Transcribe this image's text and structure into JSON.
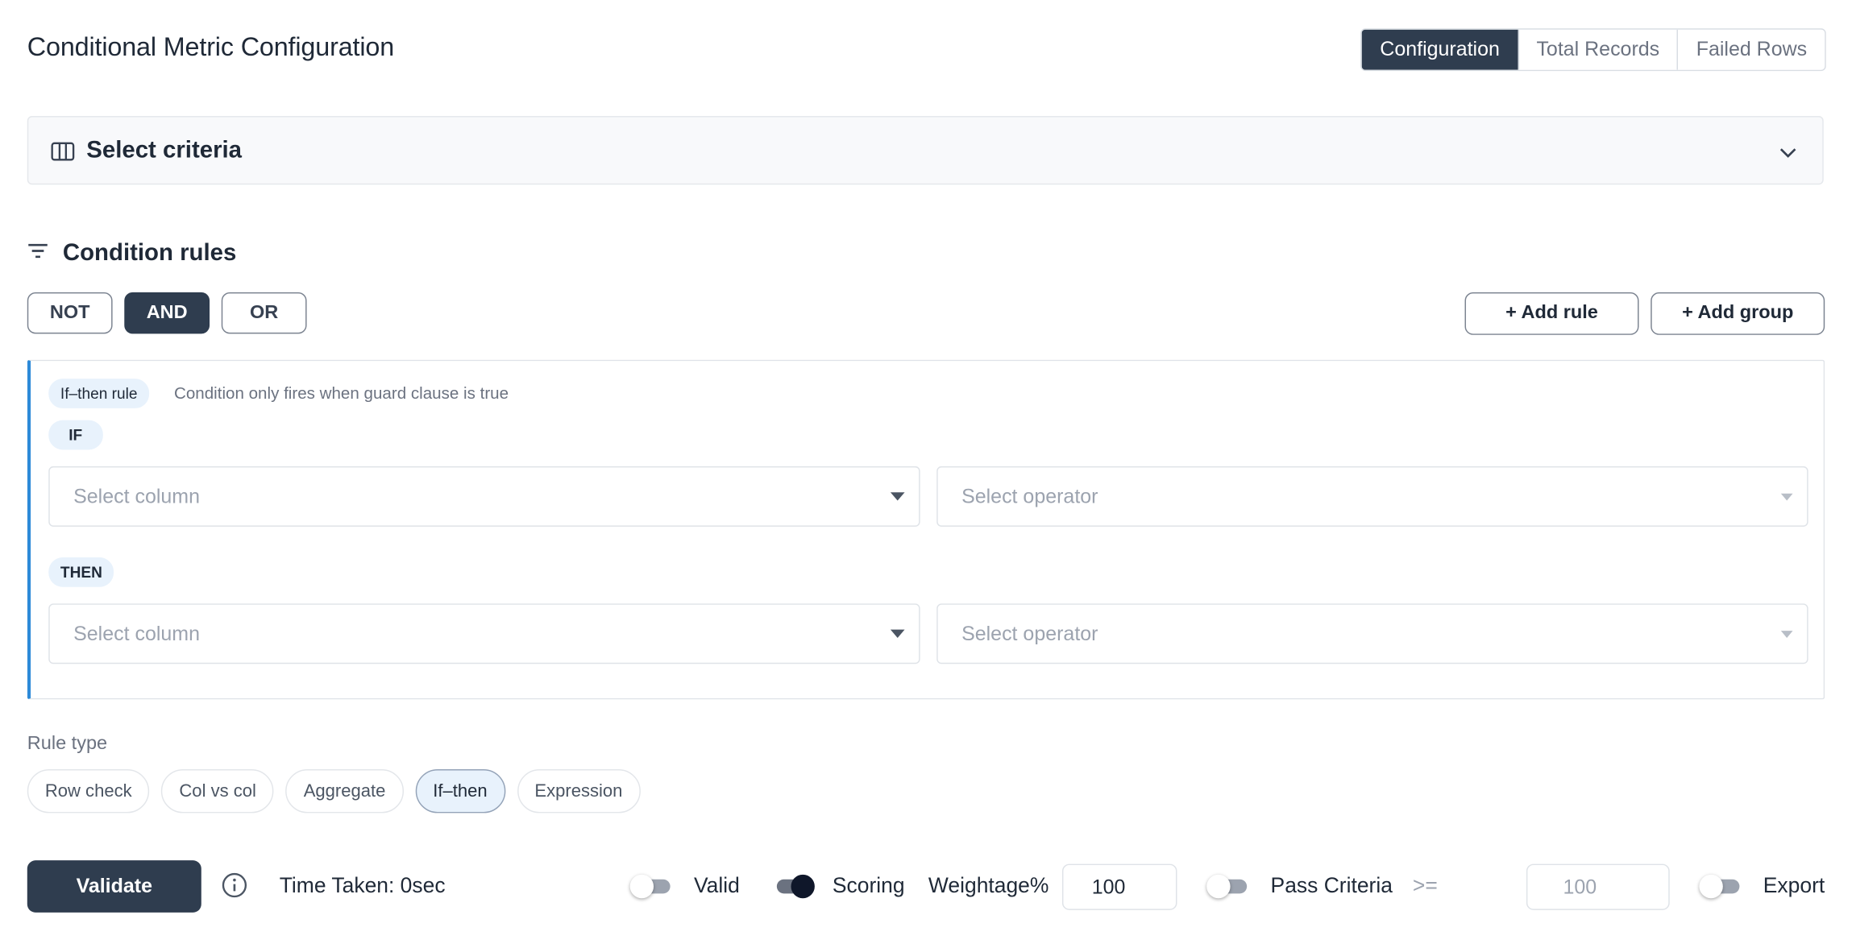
{
  "header": {
    "title": "Conditional Metric Configuration",
    "tabs": [
      {
        "label": "Configuration",
        "active": true
      },
      {
        "label": "Total Records",
        "active": false
      },
      {
        "label": "Failed Rows",
        "active": false
      }
    ]
  },
  "criteria": {
    "label": "Select criteria",
    "icon": "columns-icon",
    "expand_icon": "chevron-down-icon"
  },
  "condition_rules": {
    "title": "Condition rules",
    "icon": "filter-icon",
    "logic_buttons": [
      {
        "label": "NOT",
        "active": false
      },
      {
        "label": "AND",
        "active": true
      },
      {
        "label": "OR",
        "active": false
      }
    ],
    "add_rule_label": "+ Add rule",
    "add_group_label": "+ Add group"
  },
  "rule": {
    "type_badge": "If–then rule",
    "hint": "Condition only fires when guard clause is true",
    "if_label": "IF",
    "then_label": "THEN",
    "if_column_placeholder": "Select column",
    "if_operator_placeholder": "Select operator",
    "then_column_placeholder": "Select column",
    "then_operator_placeholder": "Select operator"
  },
  "rule_type": {
    "label": "Rule type",
    "options": [
      {
        "label": "Row check",
        "active": false
      },
      {
        "label": "Col vs col",
        "active": false
      },
      {
        "label": "Aggregate",
        "active": false
      },
      {
        "label": "If–then",
        "active": true
      },
      {
        "label": "Expression",
        "active": false
      }
    ]
  },
  "footer": {
    "validate_label": "Validate",
    "info_icon": "info-icon",
    "time_taken": "Time Taken: 0sec",
    "valid_label": "Valid",
    "valid_on": false,
    "scoring_label": "Scoring",
    "scoring_on": true,
    "weightage_label": "Weightage%",
    "weightage_value": "100",
    "pass_criteria_label": "Pass Criteria",
    "pass_criteria_on": false,
    "comparator": ">=",
    "pass_value_placeholder": "100",
    "export_label": "Export",
    "export_on": false
  },
  "colors": {
    "primary": "#2f3d4f",
    "accent_border": "#2d8ad8",
    "badge_bg": "#e8f2fc"
  }
}
